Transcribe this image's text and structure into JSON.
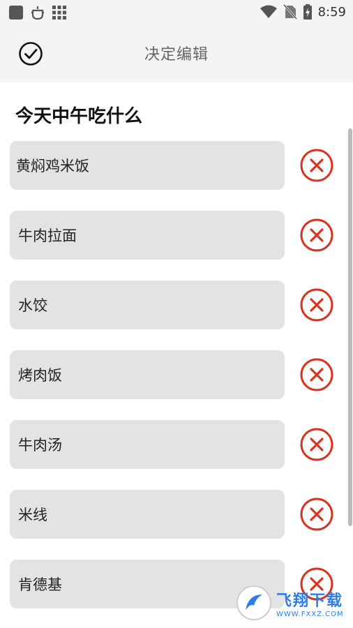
{
  "status_bar": {
    "time": "8:59",
    "icons": [
      "app-square-icon",
      "bug-icon",
      "grid-icon",
      "wifi-icon",
      "no-sim-icon",
      "battery-charging-icon"
    ]
  },
  "header": {
    "confirm_icon": "check-circle-icon",
    "title": "决定编辑"
  },
  "list": {
    "title": "今天中午吃什么",
    "items": [
      {
        "label": "黄焖鸡米饭"
      },
      {
        "label": "牛肉拉面"
      },
      {
        "label": "水饺"
      },
      {
        "label": "烤肉饭"
      },
      {
        "label": "牛肉汤"
      },
      {
        "label": "米线"
      },
      {
        "label": "肯德基"
      }
    ],
    "delete_icon": "circle-x-icon",
    "delete_color": "#d9321f"
  },
  "watermark": {
    "brand": "飞翔下载",
    "url": "WWW.FXXZ.COM"
  }
}
